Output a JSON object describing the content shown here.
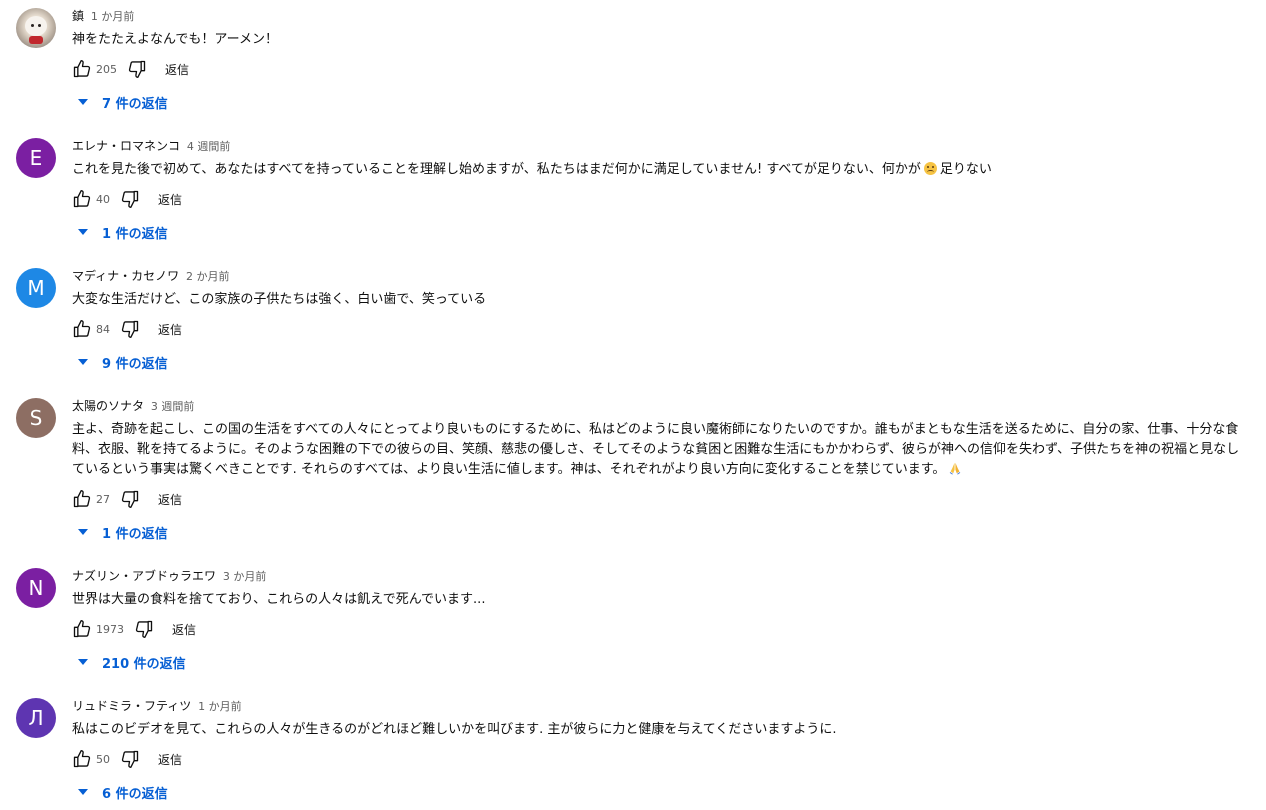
{
  "labels": {
    "reply": "返信"
  },
  "icons": {
    "like": "thumb-up-icon",
    "dislike": "thumb-down-icon",
    "expand": "caret-down-icon"
  },
  "colors": {
    "link_blue": "#065fd4",
    "meta_gray": "#606060"
  },
  "comments": [
    {
      "avatar_letter": "",
      "avatar_type": "photo",
      "author": "鎮",
      "time": "1 か月前",
      "text": "神をたたえよなんでも！アーメン！",
      "likes": "205",
      "replies": "7 件の返信"
    },
    {
      "avatar_letter": "E",
      "avatar_color": "#7b1fa2",
      "author": "エレナ・ロマネンコ",
      "time": "4 週間前",
      "text_before": "これを見た後で初めて、あなたはすべてを持っていることを理解し始めますが、私たちはまだ何かに満足していません! すべてが足りない、何かが",
      "text_after": "足りない",
      "emoji": "frowning-face-emoji",
      "likes": "40",
      "replies": "1 件の返信"
    },
    {
      "avatar_letter": "M",
      "avatar_color": "#1e88e5",
      "author": "マディナ・カセノワ",
      "time": "2 か月前",
      "text": "大変な生活だけど、この家族の子供たちは強く、白い歯で、笑っている",
      "likes": "84",
      "replies": "9 件の返信"
    },
    {
      "avatar_letter": "S",
      "avatar_color": "#8d6e63",
      "author": "太陽のソナタ",
      "time": "3 週間前",
      "text": "主よ、奇跡を起こし、この国の生活をすべての人々にとってより良いものにするために、私はどのように良い魔術師になりたいのですか。誰もがまともな生活を送るために、自分の家、仕事、十分な食料、衣服、靴を持てるように。そのような困難の下での彼らの目、笑顔、慈悲の優しさ、そしてそのような貧困と困難な生活にもかかわらず、彼らが神への信仰を失わず、子供たちを神の祝福と見なしているという事実は驚くべきことです. それらのすべては、より良い生活に値します。神は、それぞれがより良い方向に変化することを禁じています。",
      "emoji": "folded-hands-emoji",
      "likes": "27",
      "replies": "1 件の返信"
    },
    {
      "avatar_letter": "N",
      "avatar_color": "#7b1fa2",
      "author": "ナズリン・アブドゥラエワ",
      "time": "3 か月前",
      "text": "世界は大量の食料を捨てており、これらの人々は飢えで死んでいます...",
      "likes": "1973",
      "replies": "210 件の返信"
    },
    {
      "avatar_letter": "Л",
      "avatar_color": "#5e35b1",
      "author": "リュドミラ・フティツ",
      "time": "1 か月前",
      "text": "私はこのビデオを見て、これらの人々が生きるのがどれほど難しいかを叫びます. 主が彼らに力と健康を与えてくださいますように.",
      "likes": "50",
      "replies": "6 件の返信"
    }
  ]
}
